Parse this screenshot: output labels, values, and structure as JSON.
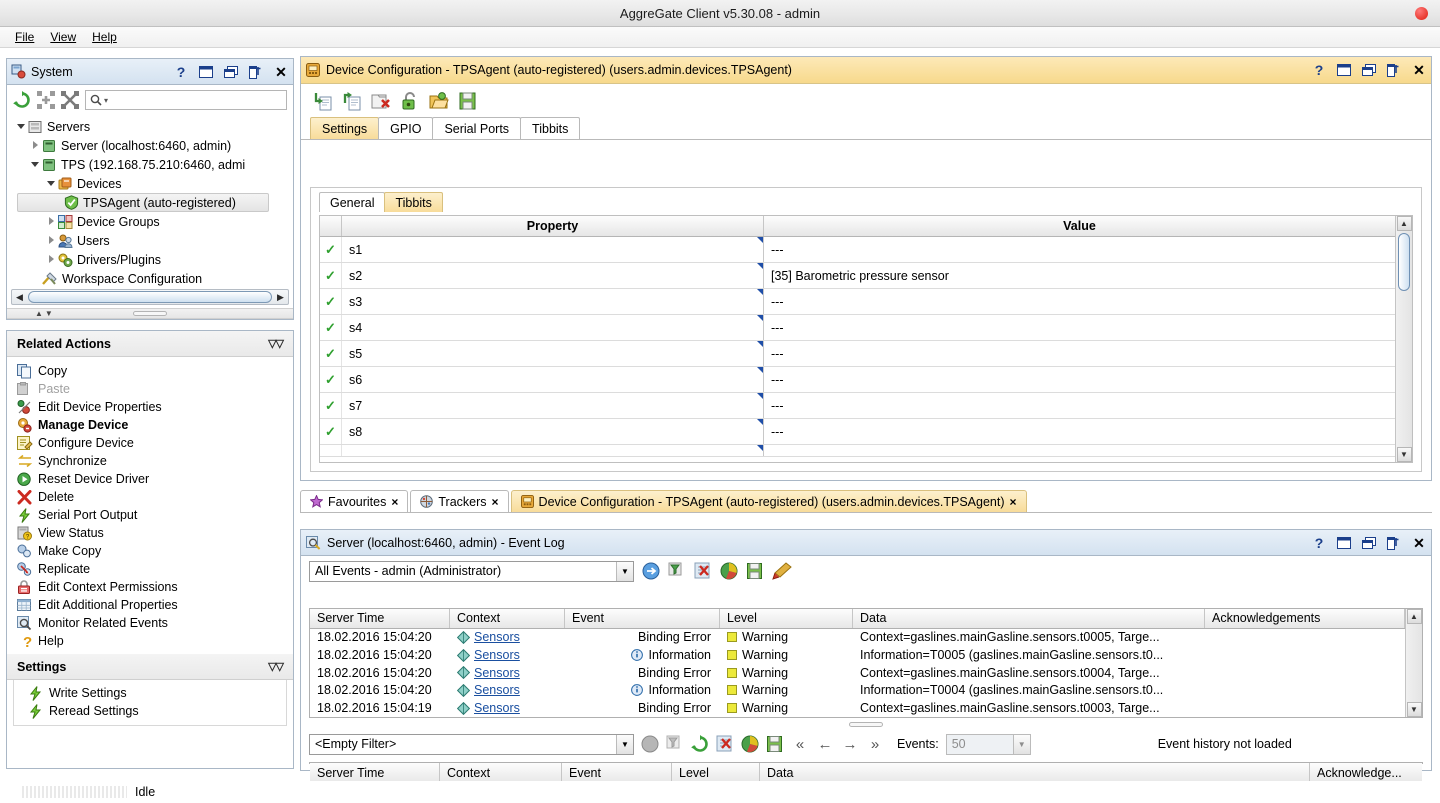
{
  "window": {
    "title": "AggreGate Client v5.30.08 - admin",
    "close_icon": "close-dot-icon"
  },
  "menubar": {
    "items": [
      {
        "label": "File"
      },
      {
        "label": "View"
      },
      {
        "label": "Help"
      }
    ]
  },
  "system_panel": {
    "title": "System",
    "icons": [
      "system-icon",
      "help-icon",
      "maximize-icon",
      "restore-icon",
      "pin-icon",
      "close-icon"
    ],
    "toolbar": [
      "refresh-icon",
      "expand-all-icon",
      "collapse-all-icon"
    ],
    "search": {
      "value": "",
      "placeholder": ""
    },
    "tree": [
      {
        "label": "Servers",
        "indent": 0,
        "twisty": "open",
        "icon": "servers-icon",
        "selected": false
      },
      {
        "label": "Server (localhost:6460, admin)",
        "indent": 1,
        "twisty": "closed",
        "icon": "server-icon",
        "selected": false
      },
      {
        "label": "TPS (192.168.75.210:6460, admi",
        "indent": 1,
        "twisty": "open",
        "icon": "server-icon",
        "selected": false
      },
      {
        "label": "Devices",
        "indent": 2,
        "twisty": "open",
        "icon": "devices-icon",
        "selected": false
      },
      {
        "label": "TPSAgent (auto-registered)",
        "indent": 3,
        "twisty": "none",
        "icon": "agent-icon",
        "selected": true
      },
      {
        "label": "Device Groups",
        "indent": 2,
        "twisty": "closed",
        "icon": "device-groups-icon",
        "selected": false
      },
      {
        "label": "Users",
        "indent": 2,
        "twisty": "closed",
        "icon": "users-icon",
        "selected": false
      },
      {
        "label": "Drivers/Plugins",
        "indent": 2,
        "twisty": "closed",
        "icon": "drivers-icon",
        "selected": false
      },
      {
        "label": "Workspace Configuration",
        "indent": 1,
        "twisty": "none",
        "icon": "workspace-icon",
        "selected": false
      }
    ]
  },
  "related_actions": {
    "title": "Related Actions",
    "items": [
      {
        "label": "Copy",
        "icon": "copy-icon",
        "state": "normal"
      },
      {
        "label": "Paste",
        "icon": "paste-icon",
        "state": "disabled"
      },
      {
        "label": "Edit Device Properties",
        "icon": "edit-properties-icon",
        "state": "normal"
      },
      {
        "label": "Manage Device",
        "icon": "manage-device-icon",
        "state": "bold"
      },
      {
        "label": "Configure Device",
        "icon": "configure-device-icon",
        "state": "normal"
      },
      {
        "label": "Synchronize",
        "icon": "synchronize-icon",
        "state": "normal"
      },
      {
        "label": "Reset Device Driver",
        "icon": "reset-driver-icon",
        "state": "normal"
      },
      {
        "label": "Delete",
        "icon": "delete-icon",
        "state": "normal"
      },
      {
        "label": "Serial Port Output",
        "icon": "serial-port-icon",
        "state": "normal"
      },
      {
        "label": "View Status",
        "icon": "view-status-icon",
        "state": "normal"
      },
      {
        "label": "Make Copy",
        "icon": "make-copy-icon",
        "state": "normal"
      },
      {
        "label": "Replicate",
        "icon": "replicate-icon",
        "state": "normal"
      },
      {
        "label": "Edit Context Permissions",
        "icon": "permissions-icon",
        "state": "normal"
      },
      {
        "label": "Edit Additional Properties",
        "icon": "additional-properties-icon",
        "state": "normal"
      },
      {
        "label": "Monitor Related Events",
        "icon": "monitor-events-icon",
        "state": "normal"
      },
      {
        "label": "Help",
        "icon": "help-icon",
        "state": "normal"
      }
    ]
  },
  "settings_section": {
    "title": "Settings",
    "items": [
      {
        "label": "Write Settings",
        "icon": "lightning-icon"
      },
      {
        "label": "Reread Settings",
        "icon": "lightning-icon"
      }
    ]
  },
  "device_config": {
    "title": "Device Configuration - TPSAgent (auto-registered) (users.admin.devices.TPSAgent)",
    "header_icon": "device-icon",
    "window_buttons": [
      "help-icon",
      "maximize-icon",
      "restore-icon",
      "pin-icon",
      "close-icon"
    ],
    "toolbar": [
      "import-icon",
      "export-icon",
      "clear-icon",
      "unlock-icon",
      "open-icon",
      "save-icon"
    ],
    "tabs": [
      {
        "label": "Settings",
        "selected": true
      },
      {
        "label": "GPIO",
        "selected": false
      },
      {
        "label": "Serial Ports",
        "selected": false
      },
      {
        "label": "Tibbits",
        "selected": false
      }
    ],
    "inner_tabs": [
      {
        "label": "General",
        "selected": false
      },
      {
        "label": "Tibbits",
        "selected": true
      }
    ],
    "table": {
      "columns": [
        "",
        "Property",
        "Value"
      ],
      "rows": [
        {
          "checked": true,
          "property": "s1",
          "value": "---"
        },
        {
          "checked": true,
          "property": "s2",
          "value": "[35] Barometric pressure sensor"
        },
        {
          "checked": true,
          "property": "s3",
          "value": "---"
        },
        {
          "checked": true,
          "property": "s4",
          "value": "---"
        },
        {
          "checked": true,
          "property": "s5",
          "value": "---"
        },
        {
          "checked": true,
          "property": "s6",
          "value": "---"
        },
        {
          "checked": true,
          "property": "s7",
          "value": "---"
        },
        {
          "checked": true,
          "property": "s8",
          "value": "---"
        }
      ]
    }
  },
  "doc_tabs": [
    {
      "label": "Favourites",
      "icon": "star-icon",
      "selected": false,
      "close": "×"
    },
    {
      "label": "Trackers",
      "icon": "tracker-icon",
      "selected": false,
      "close": "×"
    },
    {
      "label": "Device Configuration - TPSAgent (auto-registered) (users.admin.devices.TPSAgent)",
      "icon": "device-icon",
      "selected": true,
      "close": "×"
    }
  ],
  "event_log": {
    "title": "Server (localhost:6460, admin) - Event Log",
    "header_icon": "magnifier-icon",
    "window_buttons": [
      "help-icon",
      "maximize-icon",
      "restore-icon",
      "pin-icon",
      "close-icon"
    ],
    "filter_combo": {
      "value": "All Events - admin (Administrator)"
    },
    "toolbar": [
      "run-icon",
      "filter-icon",
      "clear-filter-icon",
      "chart-icon",
      "save-icon",
      "clean-icon"
    ],
    "columns": [
      "Server Time",
      "Context",
      "Event",
      "Level",
      "Data",
      "Acknowledgements"
    ],
    "rows": [
      {
        "time": "18.02.2016 15:04:20",
        "context": "Sensors",
        "event": "Binding Error",
        "event_icon": "none",
        "level": "Warning",
        "data": "Context=gaslines.mainGasline.sensors.t0005, Targe...",
        "ack": ""
      },
      {
        "time": "18.02.2016 15:04:20",
        "context": "Sensors",
        "event": "Information",
        "event_icon": "info-icon",
        "level": "Warning",
        "data": "Information=T0005 (gaslines.mainGasline.sensors.t0...",
        "ack": ""
      },
      {
        "time": "18.02.2016 15:04:20",
        "context": "Sensors",
        "event": "Binding Error",
        "event_icon": "none",
        "level": "Warning",
        "data": "Context=gaslines.mainGasline.sensors.t0004, Targe...",
        "ack": ""
      },
      {
        "time": "18.02.2016 15:04:20",
        "context": "Sensors",
        "event": "Information",
        "event_icon": "info-icon",
        "level": "Warning",
        "data": "Information=T0004 (gaslines.mainGasline.sensors.t0...",
        "ack": ""
      },
      {
        "time": "18.02.2016 15:04:19",
        "context": "Sensors",
        "event": "Binding Error",
        "event_icon": "none",
        "level": "Warning",
        "data": "Context=gaslines.mainGasline.sensors.t0003, Targe...",
        "ack": ""
      }
    ],
    "history": {
      "filter_combo": {
        "value": "<Empty Filter>"
      },
      "toolbar": [
        "run-icon",
        "filter-icon",
        "refresh-icon",
        "clear-filter-icon",
        "chart-icon",
        "save-icon"
      ],
      "nav": [
        "«",
        "←",
        "→",
        "»"
      ],
      "events_label": "Events:",
      "events_count": "50",
      "status": "Event history not loaded",
      "columns": [
        "Server Time",
        "Context",
        "Event",
        "Level",
        "Data",
        "Acknowledge..."
      ],
      "rows": []
    }
  },
  "statusbar": {
    "text": "Idle"
  },
  "colors": {
    "title_bar": "#e8e8e8",
    "panel_header": "#d4e2f0",
    "accent_orange": "#f7d98c",
    "warning_yellow": "#ece93a",
    "link_blue": "#1a4fa0",
    "check_green": "#2fa02f"
  }
}
